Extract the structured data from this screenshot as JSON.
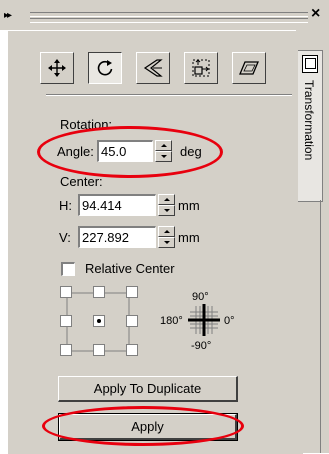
{
  "window": {
    "close_glyph": "×",
    "grip_glyph": "▸▸",
    "docker_tab": "Transformation"
  },
  "toolbar": {
    "tools": [
      {
        "icon": "position-arrows-icon",
        "active": false
      },
      {
        "icon": "rotate-icon",
        "active": true
      },
      {
        "icon": "scale-mirror-icon",
        "active": false
      },
      {
        "icon": "size-icon",
        "active": false
      },
      {
        "icon": "skew-icon",
        "active": false
      }
    ]
  },
  "rotation": {
    "section_label": "Rotation:",
    "angle_label": "Angle:",
    "angle_value": "45.0",
    "angle_unit": "deg"
  },
  "center": {
    "section_label": "Center:",
    "h_label": "H:",
    "h_value": "94.414",
    "v_label": "V:",
    "v_value": "227.892",
    "unit": "mm",
    "relative_center_label": "Relative Center",
    "relative_center_checked": false
  },
  "compass": {
    "top": "90°",
    "left": "180°",
    "right": "0°",
    "bottom": "-90°"
  },
  "buttons": {
    "apply_to_duplicate": "Apply To Duplicate",
    "apply": "Apply"
  },
  "annotation": {
    "highlight_color": "#e8000e"
  }
}
